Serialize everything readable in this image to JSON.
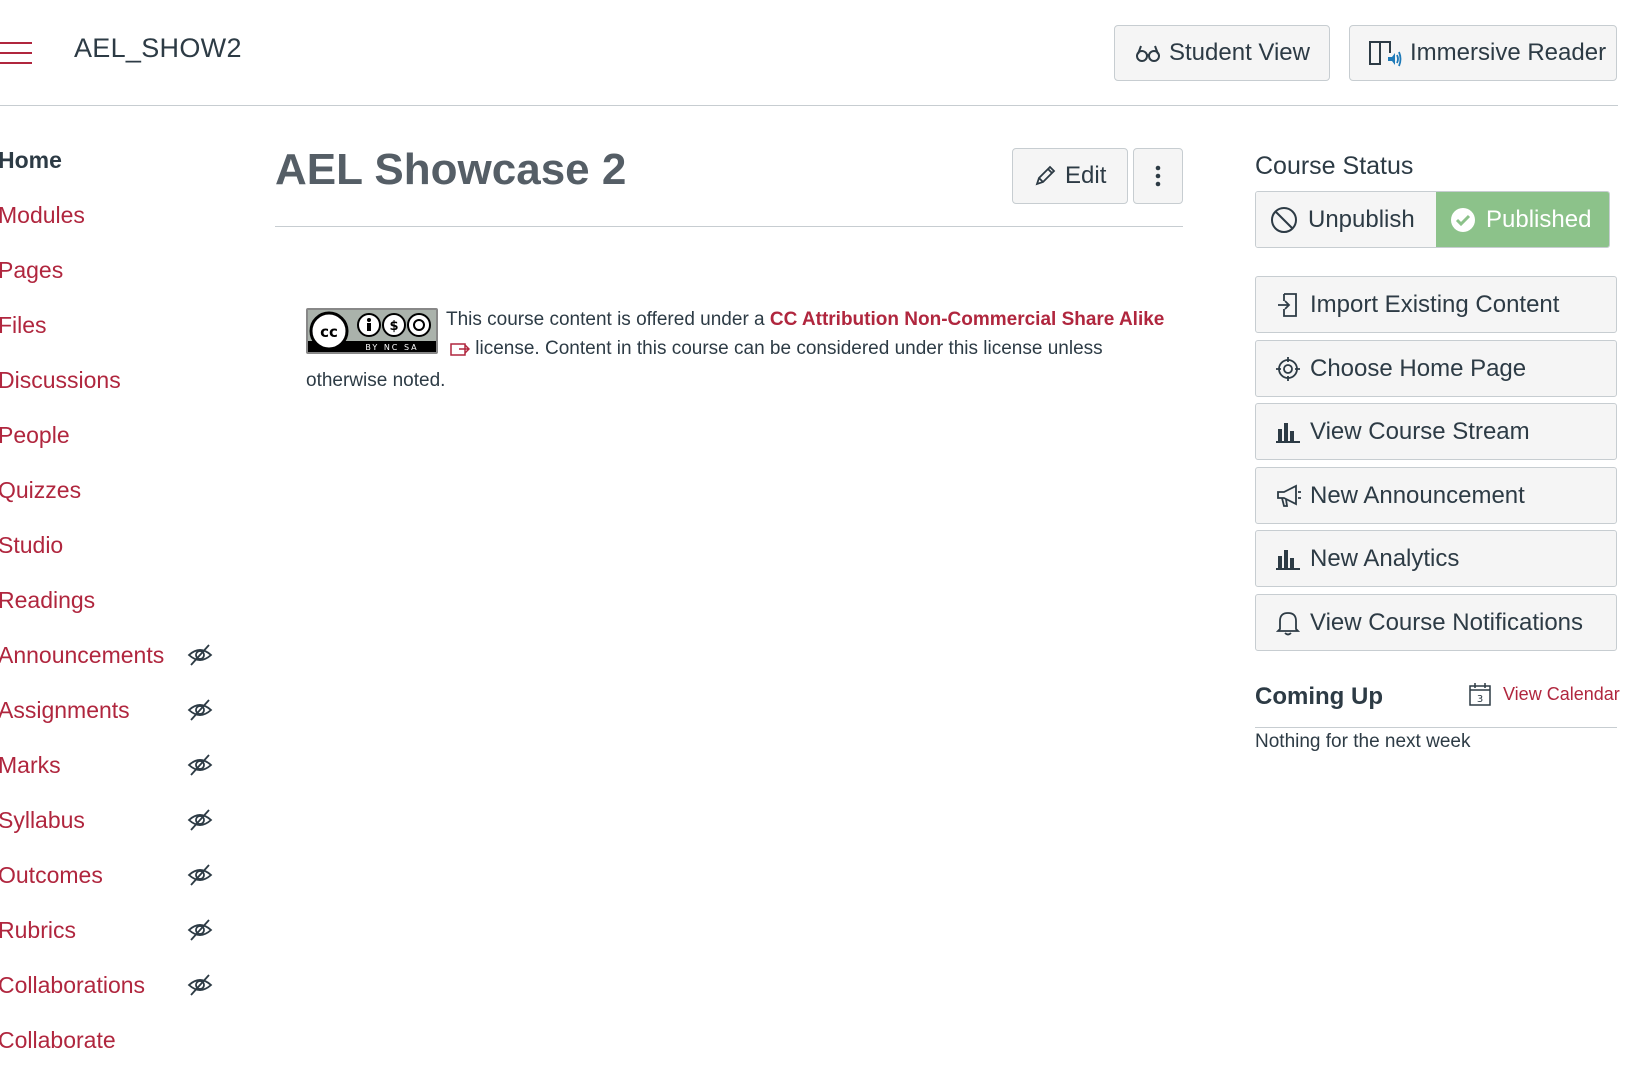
{
  "header": {
    "course_code": "AEL_SHOW2",
    "student_view_label": "Student View",
    "immersive_reader_label": "Immersive Reader"
  },
  "nav": {
    "items": [
      {
        "label": "Home",
        "active": true,
        "hidden": false
      },
      {
        "label": "Modules",
        "hidden": false
      },
      {
        "label": "Pages",
        "hidden": false
      },
      {
        "label": "Files",
        "hidden": false
      },
      {
        "label": "Discussions",
        "hidden": false
      },
      {
        "label": "People",
        "hidden": false
      },
      {
        "label": "Quizzes",
        "hidden": false
      },
      {
        "label": "Studio",
        "hidden": false
      },
      {
        "label": "Readings",
        "hidden": false
      },
      {
        "label": "Announcements",
        "hidden": true
      },
      {
        "label": "Assignments",
        "hidden": true
      },
      {
        "label": "Marks",
        "hidden": true
      },
      {
        "label": "Syllabus",
        "hidden": true
      },
      {
        "label": "Outcomes",
        "hidden": true
      },
      {
        "label": "Rubrics",
        "hidden": true
      },
      {
        "label": "Collaborations",
        "hidden": true
      },
      {
        "label": "Collaborate",
        "hidden": false
      }
    ]
  },
  "main": {
    "title": "AEL Showcase 2",
    "edit_label": "Edit",
    "license": {
      "badge_label": "BY NC SA",
      "text_before": "This course content is offered under a ",
      "link_text": "CC Attribution Non-Commercial Share Alike",
      "text_after": " license. Content in this course can be considered under this license unless otherwise noted."
    }
  },
  "sidebar": {
    "course_status_heading": "Course Status",
    "unpublish_label": "Unpublish",
    "published_label": "Published",
    "buttons": [
      {
        "label": "Import Existing Content",
        "icon": "import-icon"
      },
      {
        "label": "Choose Home Page",
        "icon": "target-icon"
      },
      {
        "label": "View Course Stream",
        "icon": "bar-chart-icon"
      },
      {
        "label": "New Announcement",
        "icon": "megaphone-icon"
      },
      {
        "label": "New Analytics",
        "icon": "bar-chart-icon"
      },
      {
        "label": "View Course Notifications",
        "icon": "bell-icon"
      }
    ],
    "coming_up_heading": "Coming Up",
    "view_calendar_label": "View Calendar",
    "calendar_day": "3",
    "nothing_text": "Nothing for the next week"
  },
  "colors": {
    "link": "#b0263e",
    "published": "#8cc28a",
    "text": "#2d3b45"
  }
}
